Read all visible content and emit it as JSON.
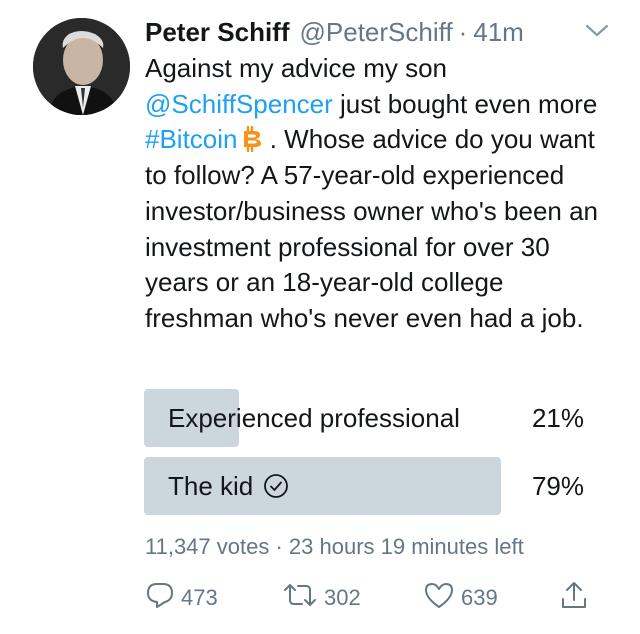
{
  "tweet": {
    "author": {
      "name": "Peter Schiff",
      "handle": "@PeterSchiff",
      "separator": "·",
      "time": "41m"
    },
    "text": {
      "part1": "Against my advice my son ",
      "mention": "@SchiffSpencer",
      "part2": " just bought even more ",
      "hashtag": "#Bitcoin",
      "part3": " . Whose advice do you want to follow? A 57-year-old experienced investor/business owner who's been an investment professional for over 30 years or an 18-year-old college freshman who's never even had a job."
    },
    "poll": {
      "options": [
        {
          "label": "Experienced professional",
          "percent_text": "21%",
          "percent": 21,
          "selected": false
        },
        {
          "label": "The kid",
          "percent_text": "79%",
          "percent": 79,
          "selected": true
        }
      ],
      "meta": "11,347 votes · 23 hours 19 minutes left"
    },
    "actions": {
      "replies": "473",
      "retweets": "302",
      "likes": "639"
    },
    "colors": {
      "link": "#1da1f2",
      "secondary_text": "#657786",
      "poll_bar": "#ccd6dd",
      "bitcoin": "#f7931a"
    },
    "icons": [
      "chevron-down-icon",
      "bitcoin-icon",
      "check-circle-icon",
      "reply-icon",
      "retweet-icon",
      "like-icon",
      "share-icon"
    ]
  }
}
